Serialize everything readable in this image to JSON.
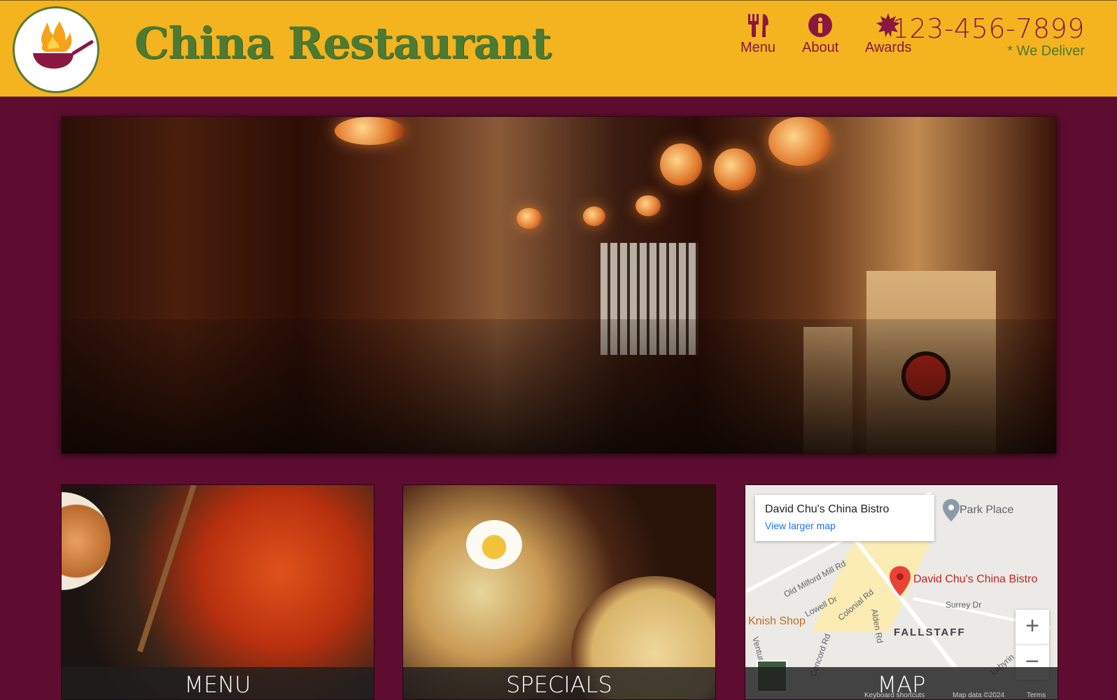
{
  "header": {
    "brand": "China Restaurant",
    "nav": [
      {
        "label": "Menu",
        "icon": "utensils-icon"
      },
      {
        "label": "About",
        "icon": "info-icon"
      },
      {
        "label": "Awards",
        "icon": "award-icon"
      }
    ],
    "phone": "123-456-7899",
    "deliver": "* We Deliver"
  },
  "cards": {
    "menu": "MENU",
    "specials": "SPECIALS",
    "map": "MAP"
  },
  "map": {
    "place_name": "David Chu's China Bistro",
    "larger_map": "View larger map",
    "pin_label": "David Chu's China Bistro",
    "park_place": "Park Place",
    "knish_shop": "Knish Shop",
    "fallstaff": "FALLSTAFF",
    "old_milford": "Old Milford Mill Rd",
    "lowell": "Lowell Dr",
    "colonial": "Colonial Rd",
    "alden": "Alden Rd",
    "surrey": "Surrey Dr",
    "concord": "Concord Rd",
    "venture": "Ventur",
    "labyrinth": "Labyrin",
    "keyboard": "Keyboard shortcuts",
    "map_data": "Map data ©2024",
    "terms": "Terms",
    "zoom_in": "+",
    "zoom_out": "−"
  },
  "colors": {
    "header_bg": "#f3b41f",
    "page_bg": "#5e0d31",
    "brand_green": "#4c7a32",
    "accent_maroon": "#8a1740"
  }
}
